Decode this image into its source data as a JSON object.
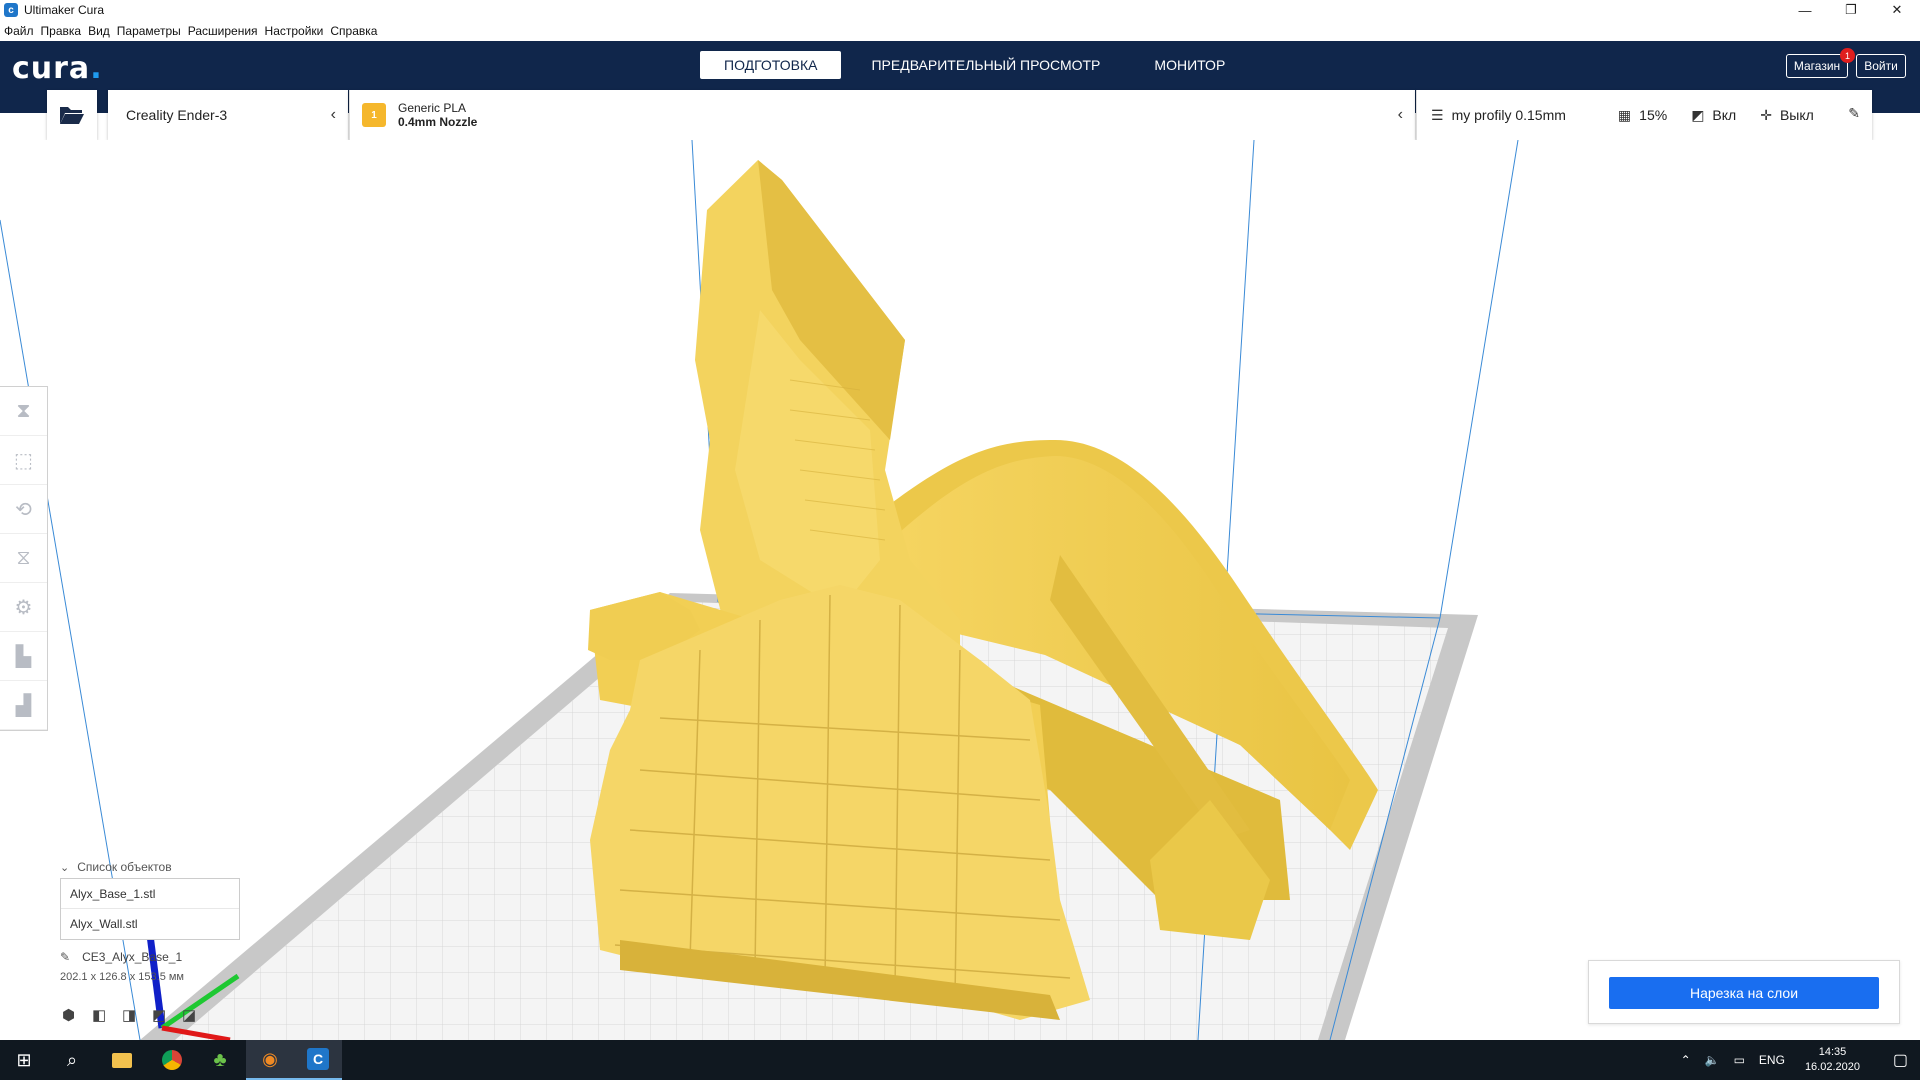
{
  "window": {
    "title": "Ultimaker Cura"
  },
  "menu": [
    "Файл",
    "Правка",
    "Вид",
    "Параметры",
    "Расширения",
    "Настройки",
    "Справка"
  ],
  "header": {
    "logo": "cura",
    "tabs": [
      {
        "label": "ПОДГОТОВКА",
        "active": true
      },
      {
        "label": "ПРЕДВАРИТЕЛЬНЫЙ ПРОСМОТР",
        "active": false
      },
      {
        "label": "МОНИТОР",
        "active": false
      }
    ],
    "marketplace_label": "Магазин",
    "marketplace_badge": "1",
    "signin_label": "Войти"
  },
  "stage": {
    "printer": "Creality Ender-3",
    "extruder_index": "1",
    "material": "Generic PLA",
    "nozzle": "0.4mm Nozzle",
    "profile": "my profily 0.15mm",
    "infill": "15%",
    "support": "Вкл",
    "adhesion": "Выкл"
  },
  "objects": {
    "header": "Список объектов",
    "items": [
      "Alyx_Base_1.stl",
      "Alyx_Wall.stl"
    ],
    "selected_name": "CE3_Alyx_Base_1",
    "dimensions": "202.1 x 126.8 x 153.5 мм"
  },
  "slice_button_label": "Нарезка на слои",
  "taskbar": {
    "language": "ENG",
    "time": "14:35",
    "date": "16.02.2020"
  },
  "colors": {
    "header": "#10264b",
    "accent": "#196ef0",
    "model": "#f7d96a"
  }
}
